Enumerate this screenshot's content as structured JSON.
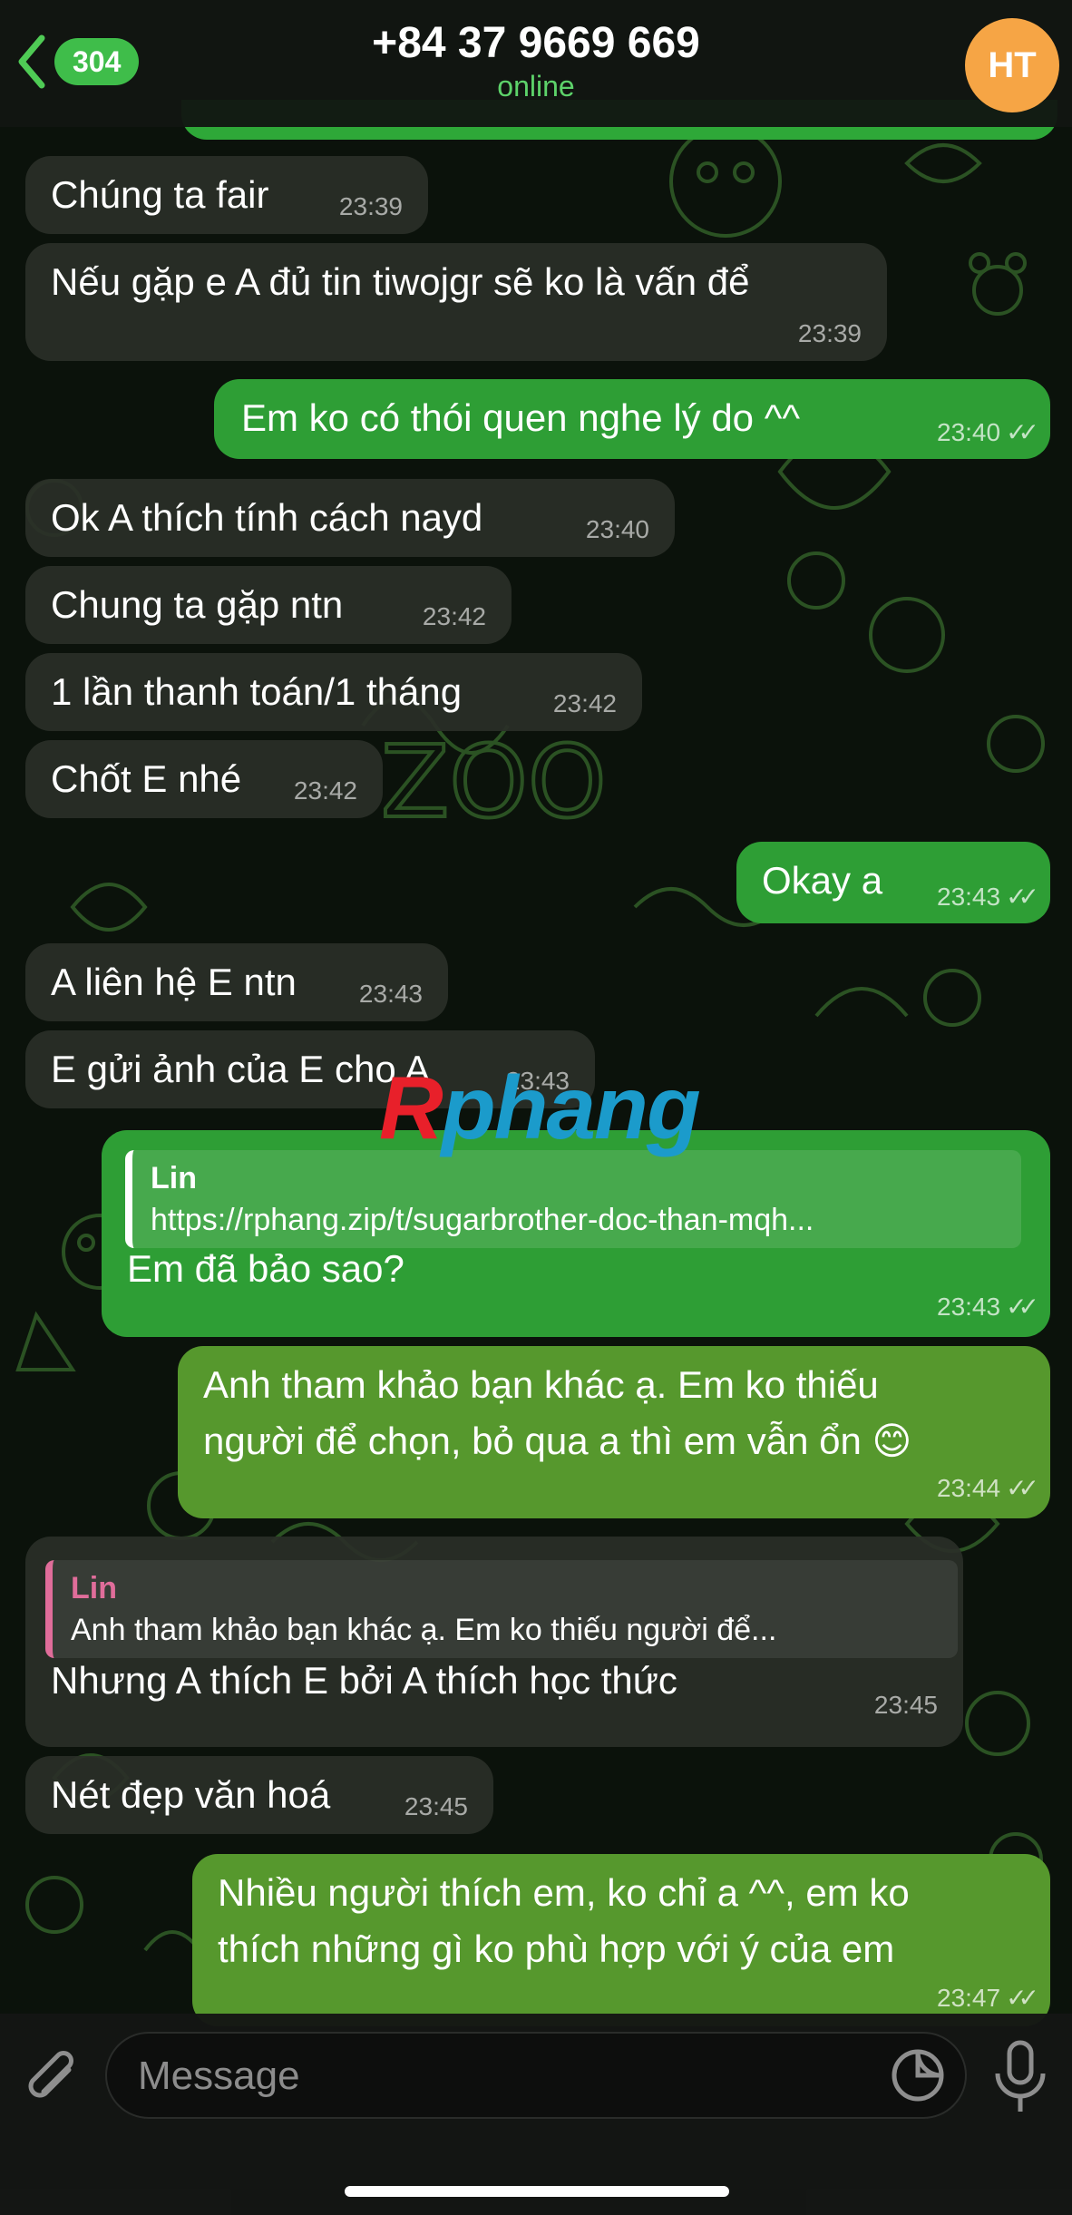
{
  "header": {
    "back_count": "304",
    "title": "+84 37 9669 669",
    "status": "online",
    "avatar_initials": "HT"
  },
  "messages": [
    {
      "dir": "in",
      "text": "Chúng ta fair",
      "time": "23:39"
    },
    {
      "dir": "in",
      "text": "Nếu gặp e A đủ tin tiwojgr sẽ ko là vấn để",
      "time": "23:39"
    },
    {
      "dir": "out",
      "text": "Em ko có thói quen nghe lý do ^^",
      "time": "23:40"
    },
    {
      "dir": "in",
      "text": "Ok A thích tính cách nayd",
      "time": "23:40"
    },
    {
      "dir": "in",
      "text": "Chung ta gặp ntn",
      "time": "23:42"
    },
    {
      "dir": "in",
      "text": "1 lần thanh toán/1 tháng",
      "time": "23:42"
    },
    {
      "dir": "in",
      "text": "Chốt E nhé",
      "time": "23:42"
    },
    {
      "dir": "out",
      "text": "Okay a",
      "time": "23:43"
    },
    {
      "dir": "in",
      "text": "A liên hệ E ntn",
      "time": "23:43"
    },
    {
      "dir": "in",
      "text": "E gửi ảnh của E cho A",
      "time": "23:43"
    },
    {
      "dir": "out",
      "quote_name": "Lin",
      "quote_text": "https://rphang.zip/t/sugarbrother-doc-than-mqh...",
      "text": "Em đã bảo sao?",
      "time": "23:43"
    },
    {
      "dir": "out",
      "text_line1": "Anh tham khảo bạn khác ạ. Em ko thiếu",
      "text_line2": "người để chọn, bỏ qua a thì em vẫn ổn 😊",
      "time": "23:44"
    },
    {
      "dir": "in",
      "quote_name": "Lin",
      "quote_text": "Anh tham khảo bạn khác ạ. Em ko thiếu người để...",
      "text": "Nhưng A thích E bởi A thích học thức",
      "time": "23:45"
    },
    {
      "dir": "in",
      "text": "Nét đẹp văn hoá",
      "time": "23:45"
    },
    {
      "dir": "out",
      "text_line1": "Nhiều người thích em, ko chỉ a ^^, em ko",
      "text_line2": "thích những gì ko phù hợp với ý của em",
      "time": "23:47"
    }
  ],
  "watermark": {
    "part1": "R",
    "part2": "phang"
  },
  "input": {
    "placeholder": "Message"
  },
  "icons": {
    "back": "chevron-left-icon",
    "attach": "paperclip-icon",
    "sticker": "sticker-icon",
    "mic": "microphone-icon",
    "read": "double-check-icon"
  },
  "colors": {
    "accent": "#3fbd4a",
    "outgoing": "#2e9e35",
    "incoming": "#2a2e28",
    "avatar": "#f6a545"
  }
}
